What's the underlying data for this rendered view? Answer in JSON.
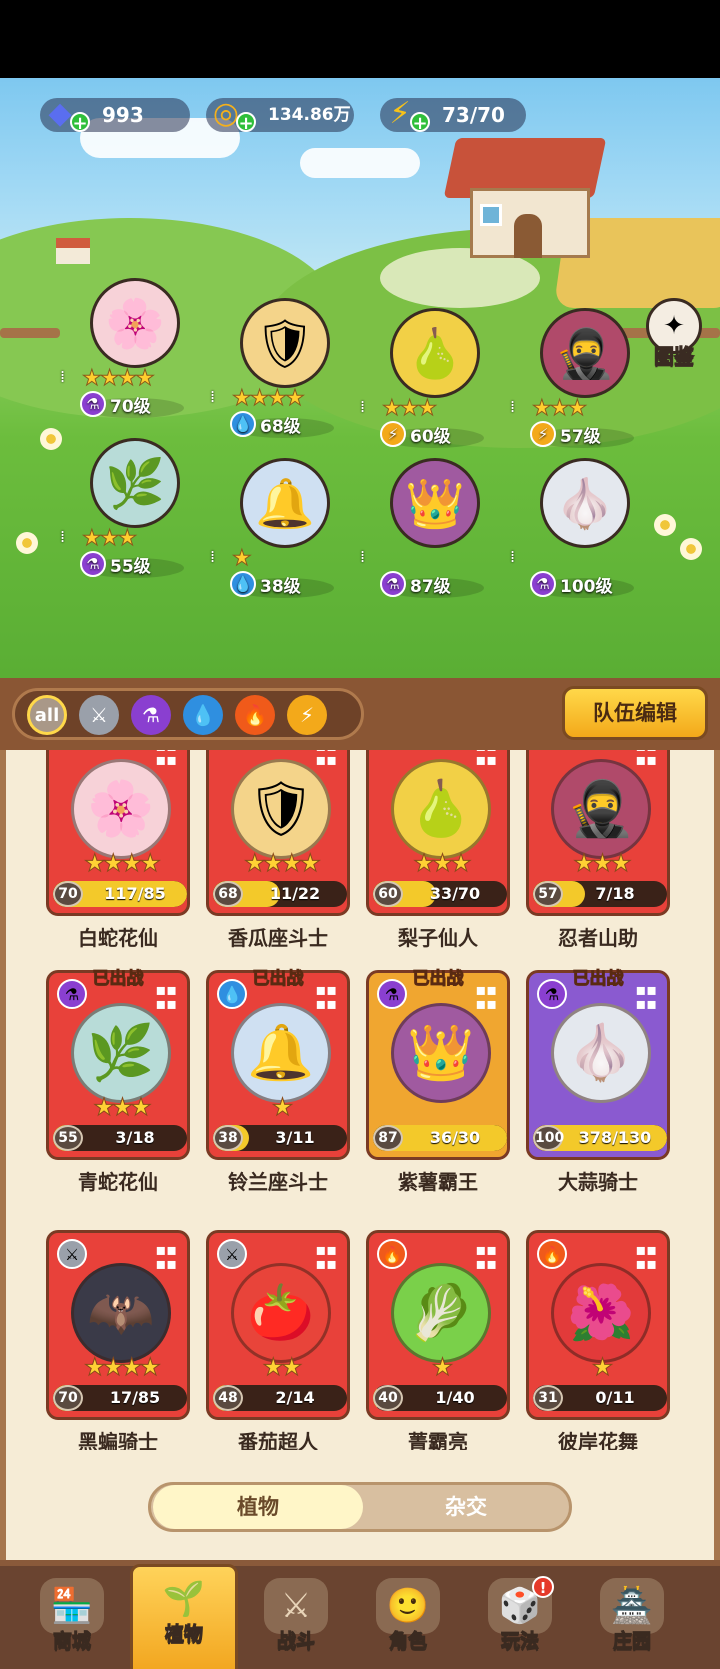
{
  "resources": {
    "gems": "993",
    "coins": "134.86万",
    "energy": "73/70"
  },
  "codex": {
    "label": "图鉴"
  },
  "team": [
    {
      "level": "70级",
      "element": "poison",
      "stars": "★★★★",
      "icon": "serpent-fairy-icon"
    },
    {
      "level": "68级",
      "element": "water",
      "stars": "★★★★",
      "icon": "warrior-icon"
    },
    {
      "level": "60级",
      "element": "thunder",
      "stars": "★★★",
      "icon": "ninja-pear-icon"
    },
    {
      "level": "57级",
      "element": "thunder",
      "stars": "★★★",
      "icon": "ninja-icon"
    },
    {
      "level": "55级",
      "element": "poison",
      "stars": "★★★",
      "icon": "green-fairy-icon"
    },
    {
      "level": "38级",
      "element": "water",
      "stars": "★",
      "icon": "lily-warrior-icon"
    },
    {
      "level": "87级",
      "element": "poison",
      "stars": "",
      "icon": "yam-king-icon"
    },
    {
      "level": "100级",
      "element": "poison",
      "stars": "",
      "icon": "garlic-knight-icon"
    }
  ],
  "filters": {
    "all_label": "all",
    "items": [
      "all",
      "sword",
      "poison",
      "water",
      "fire",
      "thunder"
    ],
    "team_edit": "队伍编辑"
  },
  "cards": [
    {
      "name": "白蛇花仙",
      "level": "70",
      "progress": "117/85",
      "fill": 1.0,
      "stars": "★★★★",
      "deployed": "",
      "element": "",
      "bg": "#e8413a"
    },
    {
      "name": "香瓜座斗士",
      "level": "68",
      "progress": "11/22",
      "fill": 0.5,
      "stars": "★★★★",
      "deployed": "",
      "element": "",
      "bg": "#e8413a"
    },
    {
      "name": "梨子仙人",
      "level": "60",
      "progress": "33/70",
      "fill": 0.47,
      "stars": "★★★",
      "deployed": "",
      "element": "",
      "bg": "#e8413a"
    },
    {
      "name": "忍者山助",
      "level": "57",
      "progress": "7/18",
      "fill": 0.39,
      "stars": "★★★",
      "deployed": "",
      "element": "",
      "bg": "#e8413a"
    },
    {
      "name": "青蛇花仙",
      "level": "55",
      "progress": "3/18",
      "fill": 0.17,
      "stars": "★★★",
      "deployed": "已出战",
      "element": "poison",
      "bg": "#e8413a"
    },
    {
      "name": "铃兰座斗士",
      "level": "38",
      "progress": "3/11",
      "fill": 0.27,
      "stars": "★",
      "deployed": "已出战",
      "element": "water",
      "bg": "#e8413a"
    },
    {
      "name": "紫薯霸王",
      "level": "87",
      "progress": "36/30",
      "fill": 1.0,
      "stars": "",
      "deployed": "已出战",
      "element": "poison",
      "bg": "#f0a630"
    },
    {
      "name": "大蒜骑士",
      "level": "100",
      "progress": "378/130",
      "fill": 1.0,
      "stars": "",
      "deployed": "已出战",
      "element": "poison",
      "bg": "#8a5ad0"
    },
    {
      "name": "黑蝙骑士",
      "level": "70",
      "progress": "17/85",
      "fill": 0.2,
      "stars": "★★★★",
      "deployed": "",
      "element": "sword",
      "bg": "#e8413a"
    },
    {
      "name": "番茄超人",
      "level": "48",
      "progress": "2/14",
      "fill": 0.14,
      "stars": "★★",
      "deployed": "",
      "element": "sword",
      "bg": "#e8413a"
    },
    {
      "name": "菁霸亮",
      "level": "40",
      "progress": "1/40",
      "fill": 0.03,
      "stars": "★",
      "deployed": "",
      "element": "fire",
      "bg": "#e8413a"
    },
    {
      "name": "彼岸花舞",
      "level": "31",
      "progress": "0/11",
      "fill": 0.0,
      "stars": "★",
      "deployed": "",
      "element": "fire",
      "bg": "#e8413a"
    }
  ],
  "toggle": {
    "plants": "植物",
    "hybrid": "杂交"
  },
  "nav": [
    {
      "label": "商城",
      "icon": "shop-icon"
    },
    {
      "label": "植物",
      "icon": "plants-icon",
      "active": true
    },
    {
      "label": "战斗",
      "icon": "battle-icon"
    },
    {
      "label": "角色",
      "icon": "character-icon"
    },
    {
      "label": "玩法",
      "icon": "gameplay-icon",
      "badge": "!"
    },
    {
      "label": "庄园",
      "icon": "manor-icon"
    }
  ],
  "colors": {
    "poison": "#8a3fd0",
    "water": "#2f8fe0",
    "thunder": "#f3a91a",
    "fire": "#f05a1a",
    "sword": "#9aa0aa"
  }
}
